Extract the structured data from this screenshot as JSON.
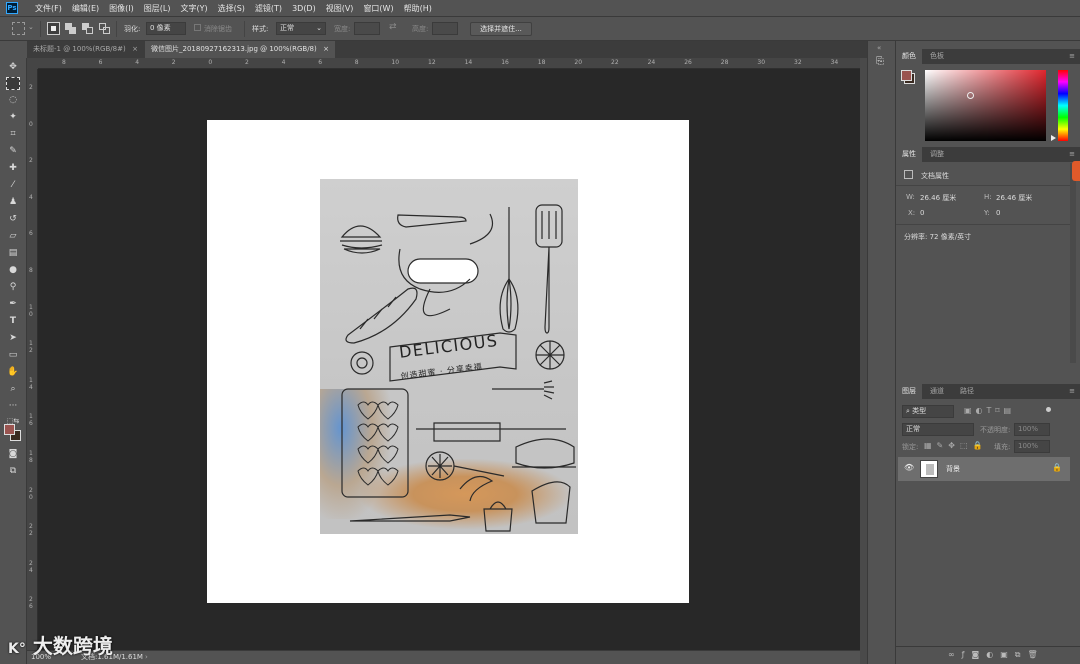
{
  "app": {
    "logo": "Ps"
  },
  "menus": [
    "文件(F)",
    "编辑(E)",
    "图像(I)",
    "图层(L)",
    "文字(Y)",
    "选择(S)",
    "滤镜(T)",
    "3D(D)",
    "视图(V)",
    "窗口(W)",
    "帮助(H)"
  ],
  "options": {
    "feather_label": "羽化:",
    "feather_value": "0 像素",
    "antialias_label": "消除锯齿",
    "style_label": "样式:",
    "style_value": "正常",
    "width_label": "宽度:",
    "height_label": "高度:",
    "select_mask_label": "选择并遮住..."
  },
  "tabs": [
    {
      "label": "未标题-1 @ 100%(RGB/8#)",
      "active": false
    },
    {
      "label": "微信图片_20180927162313.jpg @ 100%(RGB/8)",
      "active": true
    }
  ],
  "tab_close": "×",
  "ruler_top_ticks": [
    "8",
    "6",
    "4",
    "2",
    "0",
    "2",
    "4",
    "6",
    "8",
    "10",
    "12",
    "14",
    "16",
    "18",
    "20",
    "22",
    "24",
    "26",
    "28",
    "30",
    "32",
    "34"
  ],
  "ruler_left_ticks": [
    "2",
    "0",
    "2",
    "4",
    "6",
    "8",
    "1 0",
    "1 2",
    "1 4",
    "1 6",
    "1 8",
    "2 0",
    "2 2",
    "2 4",
    "2 6"
  ],
  "bag": {
    "brand_title": "DELICIOUS",
    "brand_subtitle": "创造甜蜜 · 分享幸福"
  },
  "status": {
    "zoom": "100%",
    "doc_info": "文档:1.61M/1.61M"
  },
  "panels": {
    "color_tabs": [
      "颜色",
      "色板"
    ],
    "properties_tabs": [
      "属性",
      "调整"
    ],
    "doc_props_title": "文档属性",
    "w_label": "W:",
    "w_value": "26.46 厘米",
    "h_label": "H:",
    "h_value": "26.46 厘米",
    "x_label": "X:",
    "x_value": "0",
    "y_label": "Y:",
    "y_value": "0",
    "resolution": "分辨率: 72 像素/英寸",
    "layers_tabs": [
      "图层",
      "通道",
      "路径"
    ],
    "kind_label": "类型",
    "blend_mode": "正常",
    "opacity_label": "不透明度:",
    "opacity_value": "100%",
    "lock_label": "锁定:",
    "fill_label": "填充:",
    "fill_value": "100%",
    "layer_name": "背景"
  },
  "colors": {
    "foreground": "#9a5450",
    "background": "#3a2a20",
    "panel_bg": "#535353",
    "canvas_bg": "#282828",
    "accent": "#31a8ff"
  },
  "watermark": "大数跨境"
}
